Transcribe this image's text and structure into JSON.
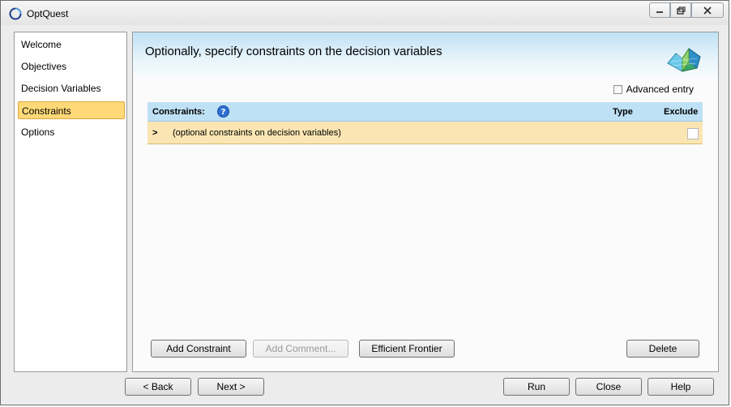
{
  "window": {
    "title": "OptQuest",
    "controls": [
      "minimize-icon",
      "restore-icon",
      "close-icon"
    ]
  },
  "sidebar": {
    "items": [
      {
        "label": "Welcome"
      },
      {
        "label": "Objectives"
      },
      {
        "label": "Decision Variables"
      },
      {
        "label": "Constraints",
        "selected": true
      },
      {
        "label": "Options"
      }
    ]
  },
  "panel": {
    "heading": "Optionally, specify constraints on the decision variables",
    "advanced_entry": {
      "label": "Advanced entry",
      "checked": false
    },
    "table": {
      "headers": {
        "constraints": "Constraints:",
        "type": "Type",
        "exclude": "Exclude"
      },
      "rows": [
        {
          "arrow": ">",
          "text": "(optional constraints on decision variables)",
          "type": "",
          "exclude": false
        }
      ]
    },
    "buttons": {
      "add_constraint": "Add Constraint",
      "add_comment": "Add Comment...",
      "efficient_frontier": "Efficient Frontier",
      "delete": "Delete"
    }
  },
  "footer": {
    "back": "< Back",
    "next": "Next >",
    "run": "Run",
    "close": "Close",
    "help": "Help"
  },
  "colors": {
    "selected_item_bg": "#ffd978",
    "header_blue": "#bfe1f5",
    "row_highlight": "#fbe6b3"
  }
}
